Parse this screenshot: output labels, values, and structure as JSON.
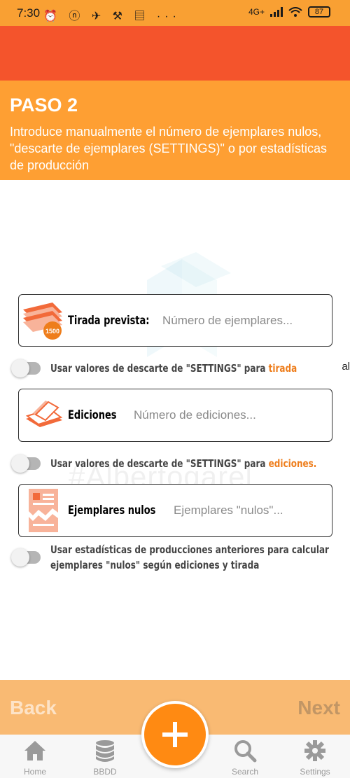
{
  "status_bar": {
    "time": "7:30",
    "left_icons": "⏰ ⓝ ✈ ⚒ ▤ ···",
    "network": "4G+",
    "battery": "87"
  },
  "header": {
    "title": "PASO 2",
    "description": "Introduce manualmente el número de ejemplares nulos, \"descarte de ejemplares (SETTINGS)\" o por estadísticas de producción"
  },
  "watermark": "#Albertogarel",
  "fields": {
    "tirada": {
      "label": "Tirada prevista:",
      "placeholder": "Número de ejemplares...",
      "icon_badge": "1500"
    },
    "ediciones": {
      "label": "Ediciones",
      "placeholder": "Número de ediciones..."
    },
    "nulos": {
      "label": "Ejemplares nulos",
      "placeholder": "Ejemplares \"nulos\"..."
    }
  },
  "toggles": {
    "tirada": {
      "text": "Usar valores de descarte de \"SETTINGS\" para ",
      "accent": "tirada",
      "overflow": "al",
      "on": false
    },
    "ediciones": {
      "text": "Usar valores de descarte de \"SETTINGS\" para ",
      "accent": "ediciones.",
      "on": false
    },
    "estadisticas": {
      "line1": "Usar estadísticas de producciones anteriores para calcular",
      "line2": "ejemplares \"nulos\" según ediciones y tirada",
      "on": false
    }
  },
  "footer": {
    "back": "Back",
    "next": "Next"
  },
  "nav": {
    "home": "Home",
    "bbdd": "BBDD",
    "search": "Search",
    "settings": "Settings"
  },
  "colors": {
    "status_bar": "#f9a033",
    "red_bar": "#f4542c",
    "header": "#fe9f33",
    "accent": "#ee7d1b",
    "fab": "#ff8a12",
    "bottom_bar": "#f9ba73"
  }
}
